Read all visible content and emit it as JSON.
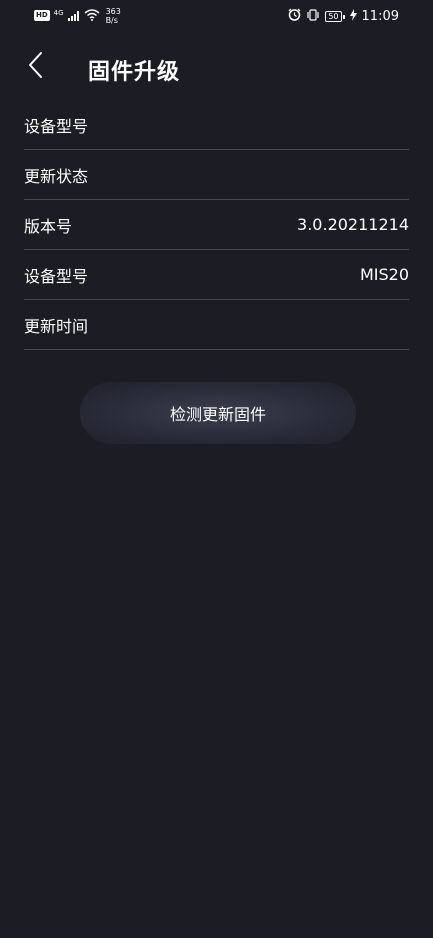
{
  "status_bar": {
    "hd": "HD",
    "network": "4G",
    "speed_value": "363",
    "speed_unit": "B/s",
    "battery": "50",
    "time": "11:09"
  },
  "header": {
    "title": "固件升级",
    "back_icon": "chevron-left-icon"
  },
  "info_rows": [
    {
      "label": "设备型号",
      "value": ""
    },
    {
      "label": "更新状态",
      "value": ""
    },
    {
      "label": "版本号",
      "value": "3.0.20211214"
    },
    {
      "label": "设备型号",
      "value": "MIS20"
    },
    {
      "label": "更新时间",
      "value": ""
    }
  ],
  "check_button": {
    "label": "检测更新固件"
  },
  "colors": {
    "background": "#1b1c24",
    "divider": "#464852",
    "button_glow": "#3c3d4f"
  }
}
